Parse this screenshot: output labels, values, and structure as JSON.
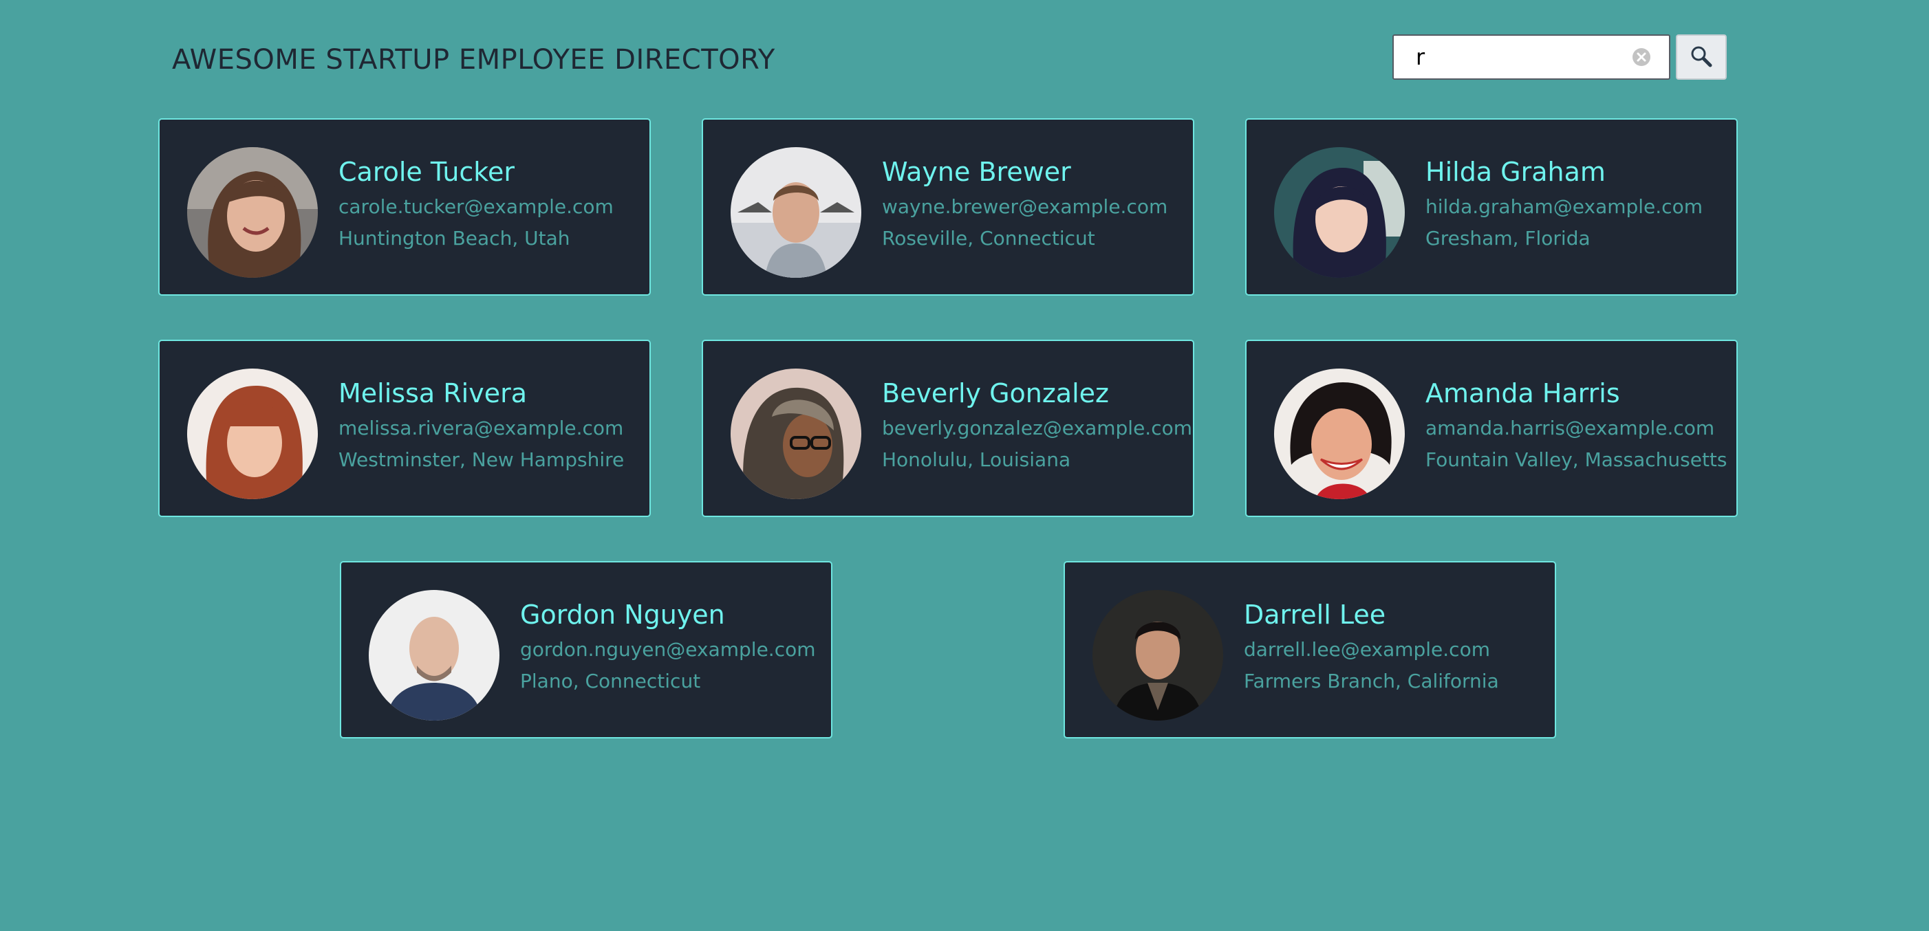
{
  "page_title": "AWESOME STARTUP EMPLOYEE DIRECTORY",
  "search": {
    "value": "r",
    "placeholder": "",
    "clear_icon": "clear-icon",
    "button_icon": "search-icon"
  },
  "colors": {
    "background": "#4aa29f",
    "card_background": "#1f2733",
    "card_border": "#6fe6e0",
    "name": "#6ff3ee",
    "detail_text": "#4aa29f"
  },
  "employees": [
    {
      "name": "Carole Tucker",
      "email": "carole.tucker@example.com",
      "location": "Huntington Beach, Utah"
    },
    {
      "name": "Wayne Brewer",
      "email": "wayne.brewer@example.com",
      "location": "Roseville, Connecticut"
    },
    {
      "name": "Hilda Graham",
      "email": "hilda.graham@example.com",
      "location": "Gresham, Florida"
    },
    {
      "name": "Melissa Rivera",
      "email": "melissa.rivera@example.com",
      "location": "Westminster, New Hampshire"
    },
    {
      "name": "Beverly Gonzalez",
      "email": "beverly.gonzalez@example.com",
      "location": "Honolulu, Louisiana"
    },
    {
      "name": "Amanda Harris",
      "email": "amanda.harris@example.com",
      "location": "Fountain Valley, Massachusetts"
    },
    {
      "name": "Gordon Nguyen",
      "email": "gordon.nguyen@example.com",
      "location": "Plano, Connecticut"
    },
    {
      "name": "Darrell Lee",
      "email": "darrell.lee@example.com",
      "location": "Farmers Branch, California"
    }
  ]
}
